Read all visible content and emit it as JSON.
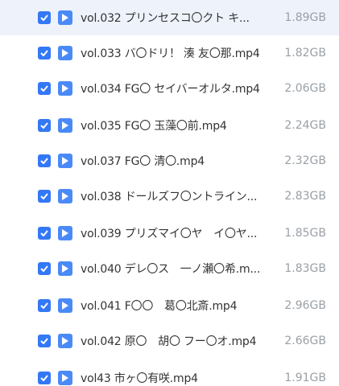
{
  "colors": {
    "checkbox": "#3478f6",
    "video_icon": "#4a8af8",
    "row_highlight": "#eef2fb",
    "name_text": "#333333",
    "size_text": "#9aa0a6"
  },
  "icons": {
    "checkbox": "checkmark-icon",
    "file_type": "video-play-icon"
  },
  "files": [
    {
      "name": "vol.032 プリンセスコ〇クト キ...",
      "size": "1.89GB",
      "checked": true
    },
    {
      "name": "vol.033 バ〇ドリ！ 湊 友〇那.mp4",
      "size": "1.82GB",
      "checked": true
    },
    {
      "name": "vol.034 FG〇 セイバーオルタ.mp4",
      "size": "2.06GB",
      "checked": true
    },
    {
      "name": "vol.035 FG〇 玉藻〇前.mp4",
      "size": "2.24GB",
      "checked": true
    },
    {
      "name": "vol.037 FG〇 清〇.mp4",
      "size": "2.32GB",
      "checked": true
    },
    {
      "name": "vol.038 ドールズフ〇ントライン...",
      "size": "2.83GB",
      "checked": true
    },
    {
      "name": "vol.039 プリズマイ〇ヤ　イ〇ヤ...",
      "size": "1.85GB",
      "checked": true
    },
    {
      "name": "vol.040 デレ〇ス　一ノ瀬〇希.m...",
      "size": "1.83GB",
      "checked": true
    },
    {
      "name": "vol.041 F〇〇　葛〇北斎.mp4",
      "size": "2.96GB",
      "checked": true
    },
    {
      "name": "vol.042 原〇　胡〇 フー〇オ.mp4",
      "size": "2.66GB",
      "checked": true
    },
    {
      "name": "vol43 市ヶ〇有咲.mp4",
      "size": "1.91GB",
      "checked": true
    }
  ]
}
